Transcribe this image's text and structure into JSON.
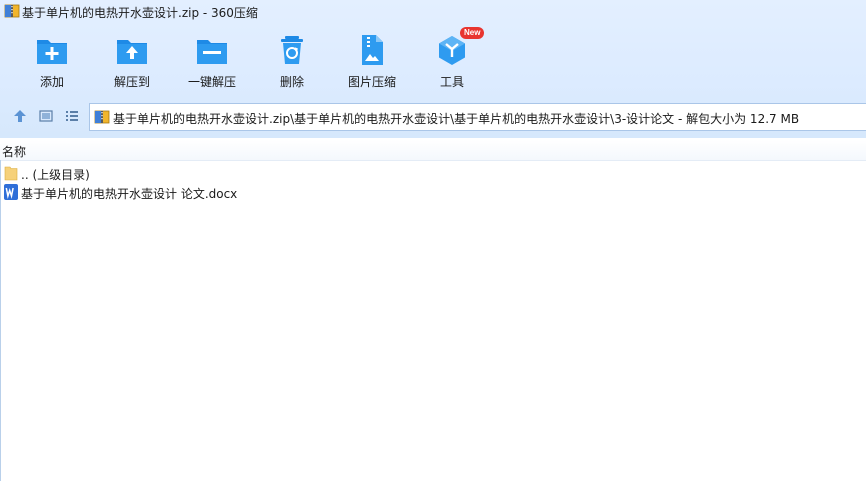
{
  "window": {
    "title": "基于单片机的电热开水壶设计.zip - 360压缩"
  },
  "toolbar": {
    "items": [
      {
        "label": "添加",
        "icon": "add-folder-icon"
      },
      {
        "label": "解压到",
        "icon": "extract-to-icon"
      },
      {
        "label": "一键解压",
        "icon": "one-click-extract-icon"
      },
      {
        "label": "删除",
        "icon": "recycle-bin-icon"
      },
      {
        "label": "图片压缩",
        "icon": "image-compress-icon"
      },
      {
        "label": "工具",
        "icon": "tools-cube-icon",
        "badge": "New"
      }
    ]
  },
  "address": {
    "path": "基于单片机的电热开水壶设计.zip\\基于单片机的电热开水壶设计\\基于单片机的电热开水壶设计\\3-设计论文 - 解包大小为 12.7 MB"
  },
  "list": {
    "column_name": "名称",
    "rows": [
      {
        "name": ".. (上级目录)",
        "icon": "folder-icon"
      },
      {
        "name": "基于单片机的电热开水壶设计 论文.docx",
        "icon": "word-doc-icon"
      }
    ]
  },
  "colors": {
    "accent": "#1e8ae6",
    "badge": "#e8352f",
    "chrome": "#dcebff"
  }
}
